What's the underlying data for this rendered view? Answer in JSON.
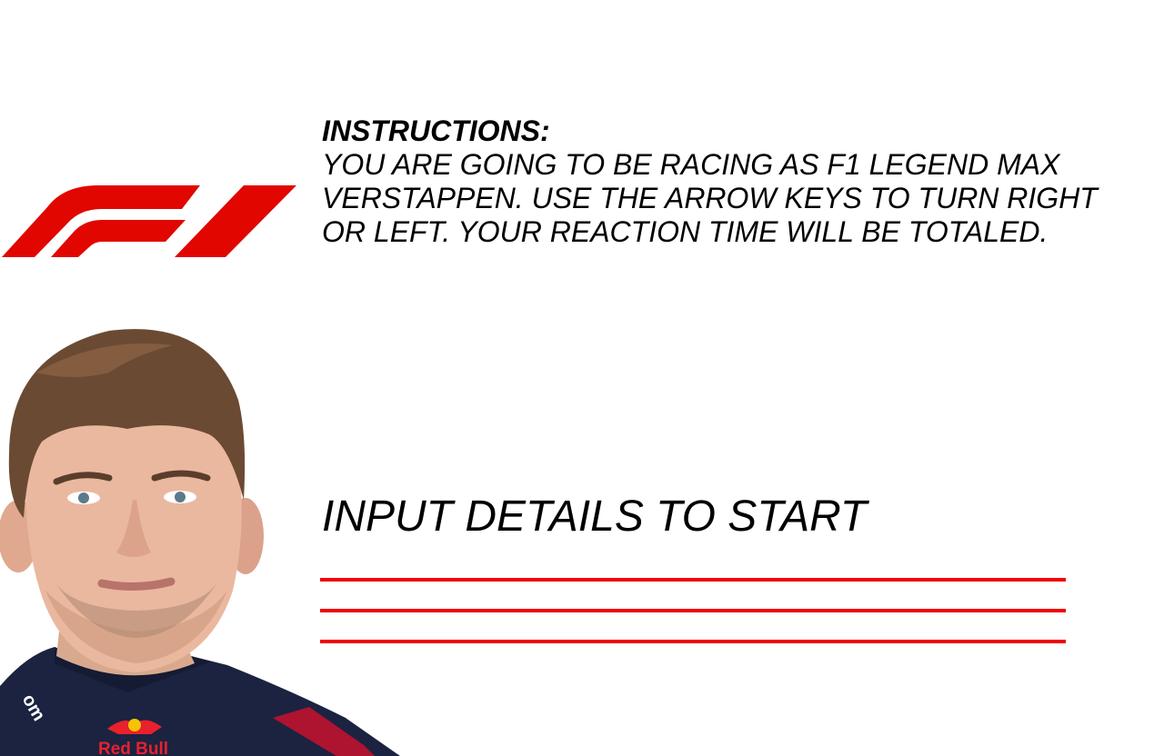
{
  "logo": {
    "icon": "f1-logo",
    "brand_color": "#e10600"
  },
  "instructions": {
    "heading": "INSTRUCTIONS:",
    "body": "YOU ARE GOING TO BE RACING AS F1 LEGEND MAX VERSTAPPEN. USE THE ARROW KEYS TO TURN RIGHT OR LEFT. YOUR REACTION TIME WILL BE TOTALED."
  },
  "start": {
    "heading": "INPUT DETAILS TO START"
  },
  "inputs": [
    {
      "value": "",
      "placeholder": ""
    },
    {
      "value": "",
      "placeholder": ""
    },
    {
      "value": "",
      "placeholder": ""
    }
  ],
  "colors": {
    "accent": "#ee0000",
    "suit": "#1b2341",
    "background": "#ffffff"
  },
  "driver_photo": {
    "suit_logo_text": "Red Bull"
  }
}
